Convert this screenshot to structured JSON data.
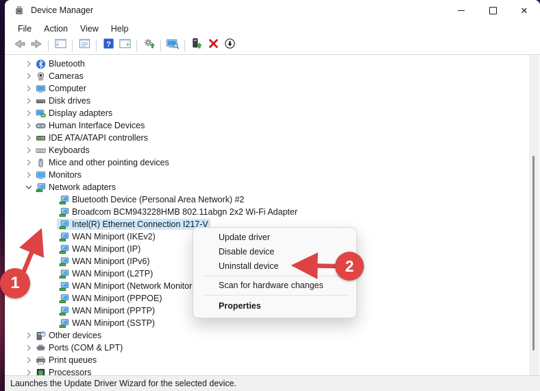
{
  "window": {
    "title": "Device Manager",
    "controls": [
      {
        "name": "minimize-button",
        "icon": "minimize-icon"
      },
      {
        "name": "maximize-button",
        "icon": "maximize-icon"
      },
      {
        "name": "close-button",
        "icon": "close-icon"
      }
    ]
  },
  "menubar": {
    "items": [
      "File",
      "Action",
      "View",
      "Help"
    ]
  },
  "toolbar": {
    "items": [
      {
        "icon": "back-icon"
      },
      {
        "icon": "forward-icon"
      },
      {
        "separator": true
      },
      {
        "icon": "console-tree-icon"
      },
      {
        "separator": true
      },
      {
        "icon": "properties-window-icon"
      },
      {
        "separator": true
      },
      {
        "icon": "help-icon"
      },
      {
        "icon": "action-pane-icon"
      },
      {
        "separator": true
      },
      {
        "icon": "scan-hardware-icon"
      },
      {
        "separator": true
      },
      {
        "icon": "remote-computer-icon"
      },
      {
        "separator": true
      },
      {
        "icon": "update-driver-icon"
      },
      {
        "icon": "uninstall-device-icon"
      },
      {
        "icon": "disable-device-icon"
      }
    ]
  },
  "tree": {
    "items": [
      {
        "label": "Bluetooth",
        "level": 1,
        "chevron": "collapsed",
        "icon": "bluetooth-icon"
      },
      {
        "label": "Cameras",
        "level": 1,
        "chevron": "collapsed",
        "icon": "camera-icon"
      },
      {
        "label": "Computer",
        "level": 1,
        "chevron": "collapsed",
        "icon": "computer-icon"
      },
      {
        "label": "Disk drives",
        "level": 1,
        "chevron": "collapsed",
        "icon": "disk-icon"
      },
      {
        "label": "Display adapters",
        "level": 1,
        "chevron": "collapsed",
        "icon": "display-adapter-icon"
      },
      {
        "label": "Human Interface Devices",
        "level": 1,
        "chevron": "collapsed",
        "icon": "hid-icon"
      },
      {
        "label": "IDE ATA/ATAPI controllers",
        "level": 1,
        "chevron": "collapsed",
        "icon": "ide-controller-icon"
      },
      {
        "label": "Keyboards",
        "level": 1,
        "chevron": "collapsed",
        "icon": "keyboard-icon"
      },
      {
        "label": "Mice and other pointing devices",
        "level": 1,
        "chevron": "collapsed",
        "icon": "mouse-icon"
      },
      {
        "label": "Monitors",
        "level": 1,
        "chevron": "collapsed",
        "icon": "monitor-icon"
      },
      {
        "label": "Network adapters",
        "level": 1,
        "chevron": "expanded",
        "icon": "network-adapter-icon"
      },
      {
        "label": "Bluetooth Device (Personal Area Network) #2",
        "level": 2,
        "icon": "network-adapter-icon"
      },
      {
        "label": "Broadcom BCM943228HMB 802.11abgn 2x2 Wi-Fi Adapter",
        "level": 2,
        "icon": "network-adapter-icon"
      },
      {
        "label": "Intel(R) Ethernet Connection I217-V",
        "level": 2,
        "icon": "network-adapter-icon",
        "selected": true
      },
      {
        "label": "WAN Miniport (IKEv2)",
        "level": 2,
        "icon": "network-adapter-icon"
      },
      {
        "label": "WAN Miniport (IP)",
        "level": 2,
        "icon": "network-adapter-icon"
      },
      {
        "label": "WAN Miniport (IPv6)",
        "level": 2,
        "icon": "network-adapter-icon"
      },
      {
        "label": "WAN Miniport (L2TP)",
        "level": 2,
        "icon": "network-adapter-icon"
      },
      {
        "label": "WAN Miniport (Network Monitor)",
        "level": 2,
        "icon": "network-adapter-icon"
      },
      {
        "label": "WAN Miniport (PPPOE)",
        "level": 2,
        "icon": "network-adapter-icon"
      },
      {
        "label": "WAN Miniport (PPTP)",
        "level": 2,
        "icon": "network-adapter-icon"
      },
      {
        "label": "WAN Miniport (SSTP)",
        "level": 2,
        "icon": "network-adapter-icon"
      },
      {
        "label": "Other devices",
        "level": 1,
        "chevron": "collapsed",
        "icon": "unknown-device-icon"
      },
      {
        "label": "Ports (COM & LPT)",
        "level": 1,
        "chevron": "collapsed",
        "icon": "ports-icon"
      },
      {
        "label": "Print queues",
        "level": 1,
        "chevron": "collapsed",
        "icon": "printer-icon"
      },
      {
        "label": "Processors",
        "level": 1,
        "chevron": "collapsed",
        "icon": "processor-icon"
      }
    ]
  },
  "context_menu": {
    "items": [
      {
        "type": "item",
        "label": "Update driver"
      },
      {
        "type": "item",
        "label": "Disable device"
      },
      {
        "type": "item",
        "label": "Uninstall device"
      },
      {
        "type": "separator"
      },
      {
        "type": "item",
        "label": "Scan for hardware changes"
      },
      {
        "type": "separator"
      },
      {
        "type": "item",
        "label": "Properties",
        "bold": true
      }
    ]
  },
  "status_bar": {
    "text": "Launches the Update Driver Wizard for the selected device."
  },
  "annotations": {
    "step1": "1",
    "step2": "2"
  },
  "colors": {
    "annotation_red": "#e04545",
    "selection_blue": "#cce8ff"
  }
}
